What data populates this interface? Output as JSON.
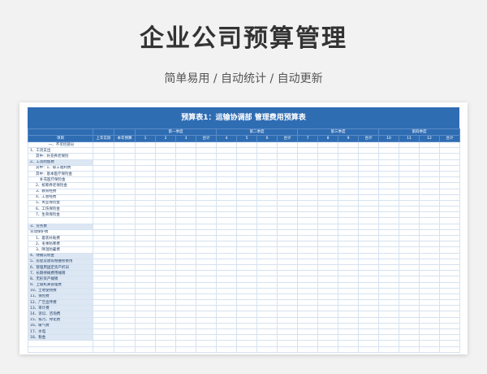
{
  "page": {
    "title": "企业公司预算管理",
    "subtitle": "简单易用 / 自动统计 / 自动更新"
  },
  "sheet": {
    "banner": "预算表1：运输协调部  管理费用预算表",
    "col_item": "项目",
    "col_last_year": "上年实际",
    "col_this_year": "本年预算",
    "quarters": [
      "第一季度",
      "第二季度",
      "第三季度",
      "第四季度"
    ],
    "months": [
      "1",
      "2",
      "3",
      "合计",
      "4",
      "5",
      "6",
      "合计",
      "7",
      "8",
      "9",
      "合计",
      "10",
      "11",
      "12",
      "合计"
    ],
    "rows": [
      {
        "label": "一、不可控部分",
        "level": "center",
        "shade": false
      },
      {
        "label": "1、工资支出",
        "level": "lv0",
        "shade": false
      },
      {
        "label": "其中：补充养老保险",
        "level": "lv1",
        "shade": false
      },
      {
        "label": "2、工资附加费",
        "level": "lv0",
        "shade": true
      },
      {
        "label": "其中：1、职工福利费",
        "level": "lv1",
        "shade": false
      },
      {
        "label": "其中：基本医疗保险金",
        "level": "lv1",
        "shade": false
      },
      {
        "label": "补充医疗保险金",
        "level": "lv2",
        "shade": false
      },
      {
        "label": "2、统筹养老保险金",
        "level": "lv1",
        "shade": false
      },
      {
        "label": "3、教育经费",
        "level": "lv1",
        "shade": false
      },
      {
        "label": "4、工会经费",
        "level": "lv1",
        "shade": false
      },
      {
        "label": "5、失业保险金",
        "level": "lv1",
        "shade": false
      },
      {
        "label": "6、工伤保险金",
        "level": "lv1",
        "shade": false
      },
      {
        "label": "7、生育保险金",
        "level": "lv1",
        "shade": false
      },
      {
        "label": "",
        "level": "lv0",
        "shade": false
      },
      {
        "label": "3、劳务费",
        "level": "lv0",
        "shade": true
      },
      {
        "label": "劳动保护费",
        "level": "lv0",
        "shade": false
      },
      {
        "label": "1、着装补助费",
        "level": "lv1",
        "shade": false
      },
      {
        "label": "2、冬季防寒费",
        "level": "lv1",
        "shade": false
      },
      {
        "label": "3、降温防暑费",
        "level": "lv1",
        "shade": false
      },
      {
        "label": "4、待摊公积金",
        "level": "lv0",
        "shade": true
      },
      {
        "label": "5、房屋及建筑物维修费用",
        "level": "lv0",
        "shade": true
      },
      {
        "label": "6、管理用固定资产折旧",
        "level": "lv0",
        "shade": true
      },
      {
        "label": "7、长期待摊费用摊销",
        "level": "lv0",
        "shade": true
      },
      {
        "label": "8、无形资产摊销",
        "level": "lv0",
        "shade": true
      },
      {
        "label": "9、上级机关管理费",
        "level": "lv0",
        "shade": true
      },
      {
        "label": "10、土地使用费",
        "level": "lv0",
        "shade": true
      },
      {
        "label": "11、保险费",
        "level": "lv0",
        "shade": true
      },
      {
        "label": "12、广告宣传费",
        "level": "lv0",
        "shade": true
      },
      {
        "label": "13、审计费",
        "level": "lv0",
        "shade": true
      },
      {
        "label": "14、诉讼、咨询费",
        "level": "lv0",
        "shade": true
      },
      {
        "label": "15、排污、绿化费",
        "level": "lv0",
        "shade": true
      },
      {
        "label": "16、暖气费",
        "level": "lv0",
        "shade": true
      },
      {
        "label": "17、水电",
        "level": "lv0",
        "shade": true
      },
      {
        "label": "18、税金",
        "level": "lv0",
        "shade": true
      },
      {
        "label": "",
        "level": "lv0",
        "shade": false
      },
      {
        "label": "",
        "level": "lv0",
        "shade": false
      }
    ]
  }
}
